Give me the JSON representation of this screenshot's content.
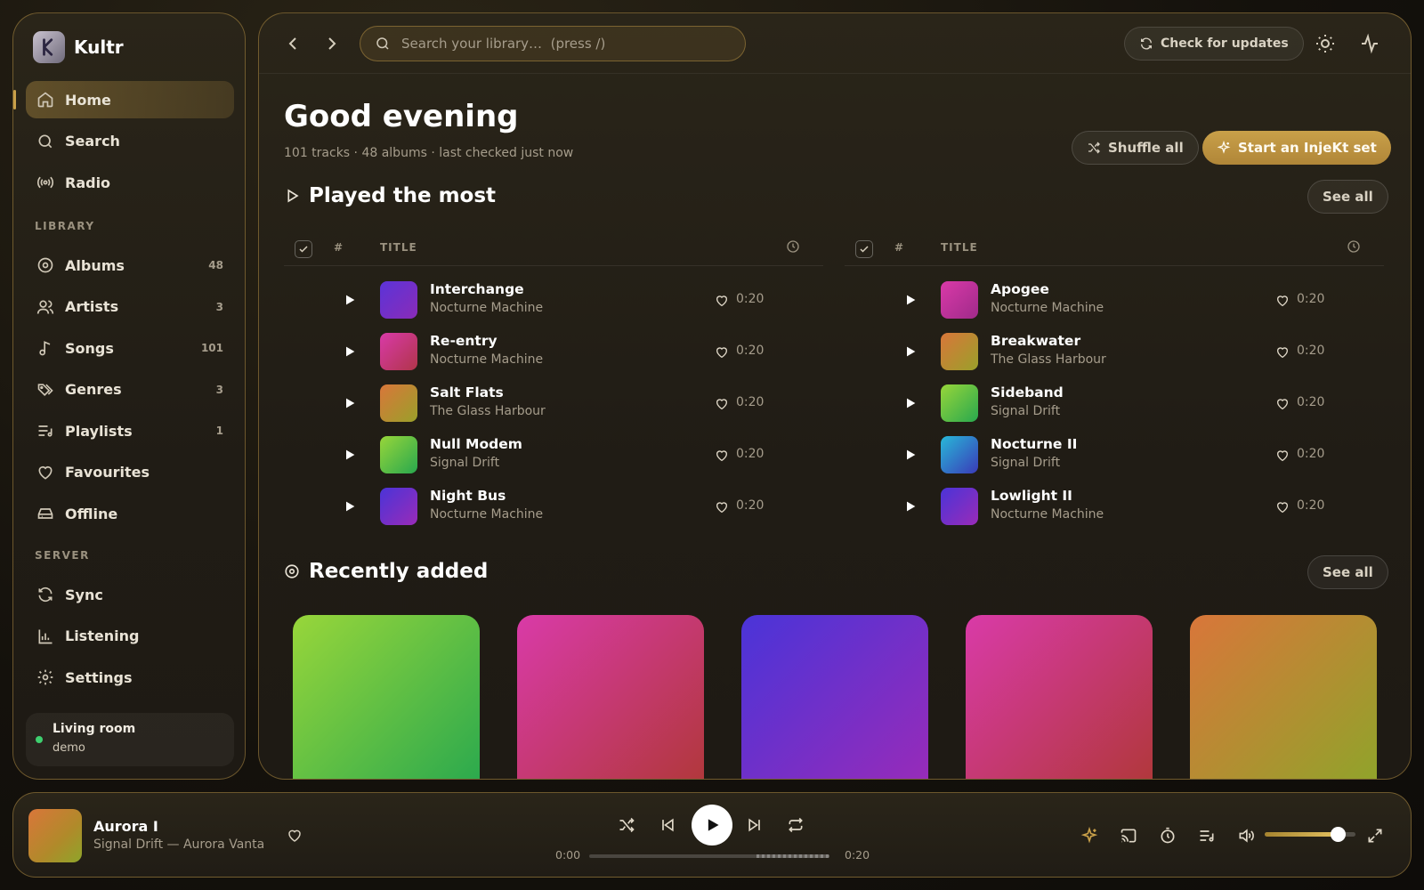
{
  "brand": {
    "name": "Kultr"
  },
  "sidebar": {
    "nav": [
      {
        "label": "Home",
        "icon": "home-icon"
      },
      {
        "label": "Search",
        "icon": "search-icon"
      },
      {
        "label": "Radio",
        "icon": "radio-icon"
      }
    ],
    "library_label": "LIBRARY",
    "library": [
      {
        "label": "Albums",
        "count": "48",
        "icon": "album-icon"
      },
      {
        "label": "Artists",
        "count": "3",
        "icon": "users-icon"
      },
      {
        "label": "Songs",
        "count": "101",
        "icon": "music-note-icon"
      },
      {
        "label": "Genres",
        "count": "3",
        "icon": "tags-icon"
      },
      {
        "label": "Playlists",
        "count": "1",
        "icon": "playlist-icon"
      },
      {
        "label": "Favourites",
        "icon": "heart-icon"
      },
      {
        "label": "Offline",
        "icon": "hard-drive-icon"
      }
    ],
    "server_label": "SERVER",
    "server": [
      {
        "label": "Sync",
        "icon": "sync-icon"
      },
      {
        "label": "Listening",
        "icon": "bar-chart-icon"
      },
      {
        "label": "Settings",
        "icon": "gear-icon"
      }
    ],
    "device": {
      "name": "Living room",
      "user": "demo",
      "status_color": "#3ecf6f"
    }
  },
  "topbar": {
    "search_placeholder": "Search your library…  (press /)",
    "check_updates": "Check for updates"
  },
  "home": {
    "greeting": "Good evening",
    "stats": "101 tracks · 48 albums · last checked just now",
    "shuffle_all": "Shuffle all",
    "start_inject": "Start an InjeKt set",
    "played_most_title": "Played the most",
    "recently_added_title": "Recently added",
    "see_all": "See all",
    "table_headers": {
      "num": "#",
      "title": "TITLE"
    },
    "tracks_left": [
      {
        "title": "Interchange",
        "artist": "Nocturne Machine",
        "duration": "0:20",
        "art": [
          "#5b34d8",
          "#8a2bb8"
        ]
      },
      {
        "title": "Re-entry",
        "artist": "Nocturne Machine",
        "duration": "0:20",
        "art": [
          "#d93aa8",
          "#b0354a"
        ]
      },
      {
        "title": "Salt Flats",
        "artist": "The Glass Harbour",
        "duration": "0:20",
        "art": [
          "#d9763a",
          "#9aa02a"
        ]
      },
      {
        "title": "Null Modem",
        "artist": "Signal Drift",
        "duration": "0:20",
        "art": [
          "#98d63a",
          "#28a84e"
        ]
      },
      {
        "title": "Night Bus",
        "artist": "Nocturne Machine",
        "duration": "0:20",
        "art": [
          "#4a34d8",
          "#9a2bb8"
        ]
      }
    ],
    "tracks_right": [
      {
        "title": "Apogee",
        "artist": "Nocturne Machine",
        "duration": "0:20",
        "art": [
          "#d93aa8",
          "#a02a8a"
        ]
      },
      {
        "title": "Breakwater",
        "artist": "The Glass Harbour",
        "duration": "0:20",
        "art": [
          "#d9763a",
          "#9aa02a"
        ]
      },
      {
        "title": "Sideband",
        "artist": "Signal Drift",
        "duration": "0:20",
        "art": [
          "#98d63a",
          "#28a84e"
        ]
      },
      {
        "title": "Nocturne II",
        "artist": "Signal Drift",
        "duration": "0:20",
        "art": [
          "#28b8d8",
          "#3a3ab8"
        ]
      },
      {
        "title": "Lowlight II",
        "artist": "Nocturne Machine",
        "duration": "0:20",
        "art": [
          "#4a34d8",
          "#9a2bb8"
        ]
      }
    ],
    "albums": [
      {
        "art": [
          "#98d63a",
          "#28a84e"
        ]
      },
      {
        "art": [
          "#d93aa8",
          "#b03838"
        ]
      },
      {
        "art": [
          "#4a34d8",
          "#9a2bb8"
        ]
      },
      {
        "art": [
          "#d93aa8",
          "#b03838"
        ]
      },
      {
        "art": [
          "#d9763a",
          "#8ea52a"
        ]
      }
    ]
  },
  "player": {
    "title": "Aurora I",
    "subtitle": "Signal Drift — Aurora Vanta",
    "elapsed": "0:00",
    "total": "0:20",
    "progress": 0.0,
    "volume": 0.8,
    "accent": "#c9a049"
  }
}
